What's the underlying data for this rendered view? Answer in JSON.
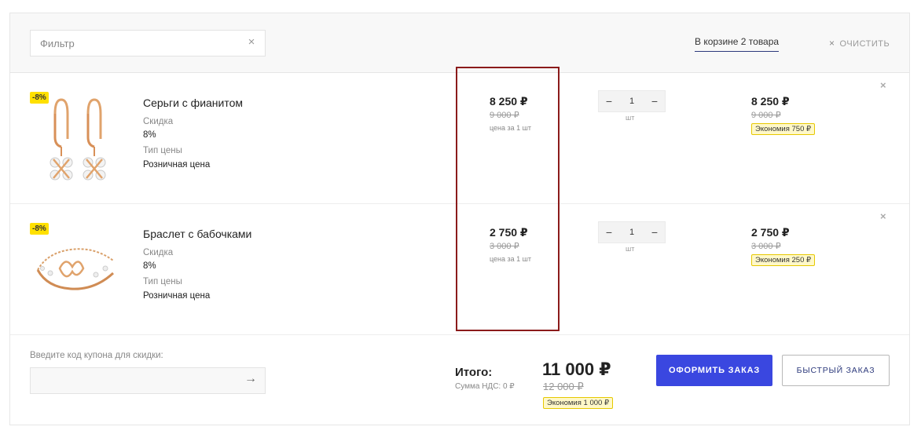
{
  "header": {
    "filter_placeholder": "Фильтр",
    "filter_clear": "×",
    "cart_count_text": "В корзине 2 товара",
    "clear_icon": "×",
    "clear_label": "ОЧИСТИТЬ"
  },
  "items": [
    {
      "badge": "-8%",
      "name": "Серьги с фианитом",
      "discount_label": "Скидка",
      "discount_value": "8%",
      "price_type_label": "Тип цены",
      "price_type_value": "Розничная цена",
      "unit_price": "8 250 ₽",
      "unit_old_price": "9 000 ₽",
      "unit_note": "цена за 1 шт",
      "quantity": "1",
      "qty_unit": "шт",
      "sum_price": "8 250 ₽",
      "sum_old_price": "9 000 ₽",
      "economy": "Экономия  750 ₽",
      "remove": "×"
    },
    {
      "badge": "-8%",
      "name": "Браслет с бабочками",
      "discount_label": "Скидка",
      "discount_value": "8%",
      "price_type_label": "Тип цены",
      "price_type_value": "Розничная цена",
      "unit_price": "2 750 ₽",
      "unit_old_price": "3 000 ₽",
      "unit_note": "цена за 1 шт",
      "quantity": "1",
      "qty_unit": "шт",
      "sum_price": "2 750 ₽",
      "sum_old_price": "3 000 ₽",
      "economy": "Экономия  250 ₽",
      "remove": "×"
    }
  ],
  "qty_controls": {
    "minus": "−",
    "plus": "−"
  },
  "footer": {
    "coupon_label": "Введите код купона для скидки:",
    "coupon_arrow": "→",
    "total_label": "Итого:",
    "vat": "Сумма НДС: 0 ₽",
    "total_price": "11 000 ₽",
    "total_old_price": "12 000 ₽",
    "total_economy": "Экономия  1 000 ₽",
    "order_button": "ОФОРМИТЬ ЗАКАЗ",
    "quick_order_button": "БЫСТРЫЙ ЗАКАЗ"
  },
  "colors": {
    "accent": "#3a47e0",
    "badge": "#ffe000",
    "highlight": "#8b1b1b"
  }
}
